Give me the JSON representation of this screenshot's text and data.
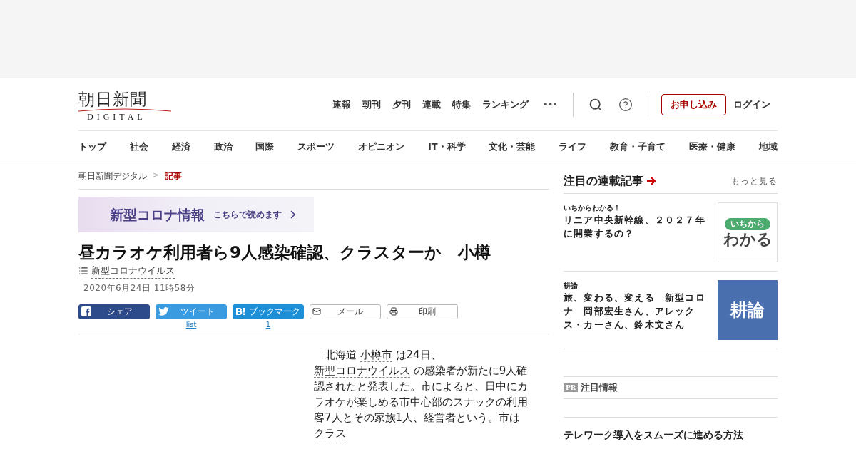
{
  "logo": {
    "title": "朝日新聞",
    "subtitle": "DIGITAL"
  },
  "top_nav": [
    "速報",
    "朝刊",
    "夕刊",
    "連載",
    "特集",
    "ランキング"
  ],
  "more": "•••",
  "subscribe": "お申し込み",
  "login": "ログイン",
  "sections": [
    {
      "label": "トップ",
      "selected": false
    },
    {
      "label": "社会",
      "selected": false
    },
    {
      "label": "経済",
      "selected": false
    },
    {
      "label": "政治",
      "selected": false
    },
    {
      "label": "国際",
      "selected": false
    },
    {
      "label": "スポーツ",
      "selected": false
    },
    {
      "label": "オピニオン",
      "selected": false
    },
    {
      "label": "IT・科学",
      "selected": false
    },
    {
      "label": "文化・芸能",
      "selected": false
    },
    {
      "label": "ライフ",
      "selected": false
    },
    {
      "label": "教育・子育て",
      "selected": false
    },
    {
      "label": "医療・健康",
      "selected": false
    },
    {
      "label": "地域",
      "selected": false
    }
  ],
  "breadcrumb": [
    {
      "label": "朝日新聞デジタル",
      "selected": false
    },
    {
      "label": "記事",
      "selected": true
    }
  ],
  "breadcrumb_separator": ">",
  "banner": {
    "title": "新型コロナ情報",
    "link": "こちらで読めます"
  },
  "article": {
    "headline": "昼カラオケ利用者ら9人感染確認、クラスターか　小樽",
    "topic": "新型コロナウイルス",
    "date": "2020年6月24日 11時58分",
    "share": [
      {
        "kind": "facebook",
        "label": "シェア"
      },
      {
        "kind": "twitter",
        "label": "ツイート",
        "count": "list"
      },
      {
        "kind": "hatena",
        "label": "ブックマーク",
        "count": "1"
      },
      {
        "kind": "mail",
        "label": "メール"
      },
      {
        "kind": "print",
        "label": "印刷"
      }
    ],
    "body": [
      {
        "text": "北海道 ",
        "link": false
      },
      {
        "text": "小樽市",
        "link": true
      },
      {
        "text": " は24日、 ",
        "link": false
      },
      {
        "text": "新型コロナウイルス",
        "link": true
      },
      {
        "text": " の感染者が新たに9人確認されたと発表した。市によると、日中にカラオケが楽しめる市中心部のスナックの利用客7人とその家族1人、経営者という。市は ",
        "link": false
      },
      {
        "text": "クラス",
        "link": true
      }
    ]
  },
  "sidebar": {
    "title": "注目の連載記事",
    "more": "もっと見る",
    "items": [
      {
        "kind": "ichikara",
        "series": "いちからわかる！",
        "title": "リニア中央新幹線、２０２７年に開業するの？",
        "thumb_top": "いちから",
        "thumb_main": "わかる"
      },
      {
        "kind": "koron",
        "series": "耕論",
        "title": "旅、変わる、変える　新型コロナ　岡部宏生さん、アレックス・カーさん、鈴木文さん",
        "thumb_main": "耕論"
      }
    ],
    "pr_badge": "PR",
    "pr_title": "注目情報",
    "promo": "テレワーク導入をスムーズに進める方法"
  }
}
